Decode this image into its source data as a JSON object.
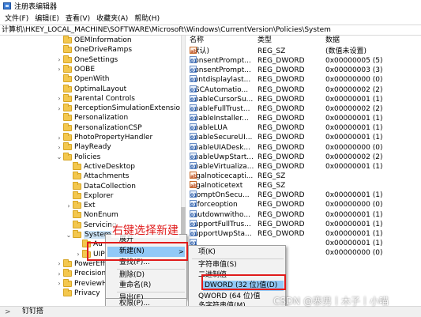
{
  "window": {
    "title": "注册表编辑器"
  },
  "menu": [
    "文件(F)",
    "编辑(E)",
    "查看(V)",
    "收藏夹(A)",
    "帮助(H)"
  ],
  "address": "计算机\\HKEY_LOCAL_MACHINE\\SOFTWARE\\Microsoft\\Windows\\CurrentVersion\\Policies\\System",
  "tree": [
    {
      "label": "OEMInformation",
      "chev": ""
    },
    {
      "label": "OneDriveRamps",
      "chev": ""
    },
    {
      "label": "OneSettings",
      "chev": ">"
    },
    {
      "label": "OOBE",
      "chev": ">"
    },
    {
      "label": "OpenWith",
      "chev": ""
    },
    {
      "label": "OptimalLayout",
      "chev": ""
    },
    {
      "label": "Parental Controls",
      "chev": ">"
    },
    {
      "label": "PerceptionSimulationExtensions",
      "chev": ">"
    },
    {
      "label": "Personalization",
      "chev": ""
    },
    {
      "label": "PersonalizationCSP",
      "chev": ""
    },
    {
      "label": "PhotoPropertyHandler",
      "chev": ">"
    },
    {
      "label": "PlayReady",
      "chev": ">"
    },
    {
      "label": "Policies",
      "chev": "v"
    },
    {
      "label": "ActiveDesktop",
      "chev": ""
    },
    {
      "label": "Attachments",
      "chev": ""
    },
    {
      "label": "DataCollection",
      "chev": ""
    },
    {
      "label": "Explorer",
      "chev": ""
    },
    {
      "label": "Ext",
      "chev": ">"
    },
    {
      "label": "NonEnum",
      "chev": ""
    },
    {
      "label": "Servicing",
      "chev": ""
    },
    {
      "label": "System",
      "chev": "v"
    },
    {
      "label": "Au",
      "chev": ""
    },
    {
      "label": "UIP",
      "chev": ">"
    },
    {
      "label": "PowerEff",
      "chev": ">"
    },
    {
      "label": "Precision",
      "chev": ">"
    },
    {
      "label": "PreviewH",
      "chev": ">"
    },
    {
      "label": "Privacy",
      "chev": ""
    }
  ],
  "columns": {
    "name": "名称",
    "type": "类型",
    "data": "数据"
  },
  "values": [
    {
      "icon": "ab",
      "name": "(默认)",
      "type": "REG_SZ",
      "data": "(数值未设置)"
    },
    {
      "icon": "dw",
      "name": "ConsentPrompt...",
      "type": "REG_DWORD",
      "data": "0x00000005 (5)"
    },
    {
      "icon": "dw",
      "name": "ConsentPrompt...",
      "type": "REG_DWORD",
      "data": "0x00000003 (3)"
    },
    {
      "icon": "dw",
      "name": "dontdisplaylast...",
      "type": "REG_DWORD",
      "data": "0x00000000 (0)"
    },
    {
      "icon": "dw",
      "name": "DSCAutomatio...",
      "type": "REG_DWORD",
      "data": "0x00000002 (2)"
    },
    {
      "icon": "dw",
      "name": "EnableCursorSu...",
      "type": "REG_DWORD",
      "data": "0x00000001 (1)"
    },
    {
      "icon": "dw",
      "name": "EnableFullTrust...",
      "type": "REG_DWORD",
      "data": "0x00000002 (2)"
    },
    {
      "icon": "dw",
      "name": "EnableInstaller...",
      "type": "REG_DWORD",
      "data": "0x00000001 (1)"
    },
    {
      "icon": "dw",
      "name": "EnableLUA",
      "type": "REG_DWORD",
      "data": "0x00000001 (1)"
    },
    {
      "icon": "dw",
      "name": "EnableSecureUI...",
      "type": "REG_DWORD",
      "data": "0x00000001 (1)"
    },
    {
      "icon": "dw",
      "name": "EnableUIADesk...",
      "type": "REG_DWORD",
      "data": "0x00000000 (0)"
    },
    {
      "icon": "dw",
      "name": "EnableUwpStart...",
      "type": "REG_DWORD",
      "data": "0x00000002 (2)"
    },
    {
      "icon": "dw",
      "name": "EnableVirtualiza...",
      "type": "REG_DWORD",
      "data": "0x00000001 (1)"
    },
    {
      "icon": "ab",
      "name": "legalnoticecapti...",
      "type": "REG_SZ",
      "data": ""
    },
    {
      "icon": "ab",
      "name": "legalnoticetext",
      "type": "REG_SZ",
      "data": ""
    },
    {
      "icon": "dw",
      "name": "PromptOnSecu...",
      "type": "REG_DWORD",
      "data": "0x00000001 (1)"
    },
    {
      "icon": "dw",
      "name": "scforceoption",
      "type": "REG_DWORD",
      "data": "0x00000000 (0)"
    },
    {
      "icon": "dw",
      "name": "shutdownwitho...",
      "type": "REG_DWORD",
      "data": "0x00000001 (1)"
    },
    {
      "icon": "dw",
      "name": "SupportFullTrus...",
      "type": "REG_DWORD",
      "data": "0x00000001 (1)"
    },
    {
      "icon": "dw",
      "name": "SupportUwpSta...",
      "type": "REG_DWORD",
      "data": "0x00000001 (1)"
    },
    {
      "icon": "dw",
      "name": "",
      "type": "",
      "data": "0x00000001 (1)"
    },
    {
      "icon": "",
      "name": "",
      "type": "",
      "data": "0x00000000 (0)"
    }
  ],
  "context_menu": {
    "items": [
      "展开",
      "新建(N)",
      "查找(F)...",
      "删除(D)",
      "重命名(R)",
      "导出(E)",
      "权限(P)..."
    ]
  },
  "submenu": {
    "items": [
      "项(K)",
      "字符串值(S)",
      "二进制值",
      "DWORD (32 位)值(D)",
      "QWORD (64 位)值",
      "多字符串值(M)"
    ]
  },
  "annotation": {
    "text": "右键选择新建"
  },
  "statusbar": {
    "text": "钉钉搭"
  },
  "watermark": {
    "text": "CSDN @寨男丨木子丨小喵"
  }
}
